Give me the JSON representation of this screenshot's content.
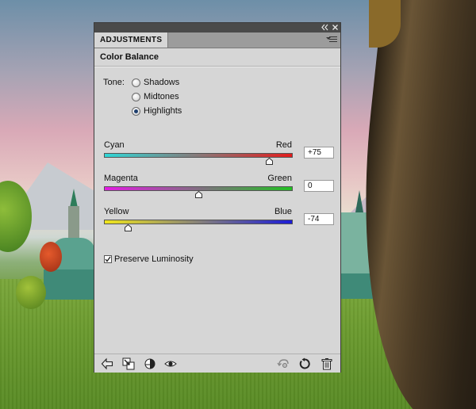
{
  "panel": {
    "tab_label": "ADJUSTMENTS",
    "title": "Color Balance",
    "tone_label": "Tone:",
    "tone_options": [
      {
        "label": "Shadows",
        "selected": false
      },
      {
        "label": "Midtones",
        "selected": false
      },
      {
        "label": "Highlights",
        "selected": true
      }
    ],
    "sliders": [
      {
        "left": "Cyan",
        "right": "Red",
        "value": "+75",
        "position": 0.875,
        "gradient": [
          "#2fd6d6",
          "#e21c1c"
        ]
      },
      {
        "left": "Magenta",
        "right": "Green",
        "value": "0",
        "position": 0.5,
        "gradient": [
          "#e21ce2",
          "#22c022"
        ]
      },
      {
        "left": "Yellow",
        "right": "Blue",
        "value": "-74",
        "position": 0.13,
        "gradient": [
          "#f0e61c",
          "#1c1cd8"
        ]
      }
    ],
    "preserve_luminosity": {
      "label": "Preserve Luminosity",
      "checked": true
    }
  },
  "titlebar": {
    "collapse_icon": "double-chevron-left-icon",
    "close_icon": "close-icon"
  },
  "toolbar": {
    "left": [
      "back-arrow-icon",
      "clip-to-layer-icon",
      "layer-visibility-circle-icon",
      "eye-icon"
    ],
    "right": [
      "view-previous-state-icon",
      "reset-icon",
      "trash-icon"
    ]
  },
  "colors": {
    "panel_bg": "#d6d6d6",
    "titlebar_bg": "#4a4a4a",
    "radio_selected": "#1e3f6e"
  }
}
